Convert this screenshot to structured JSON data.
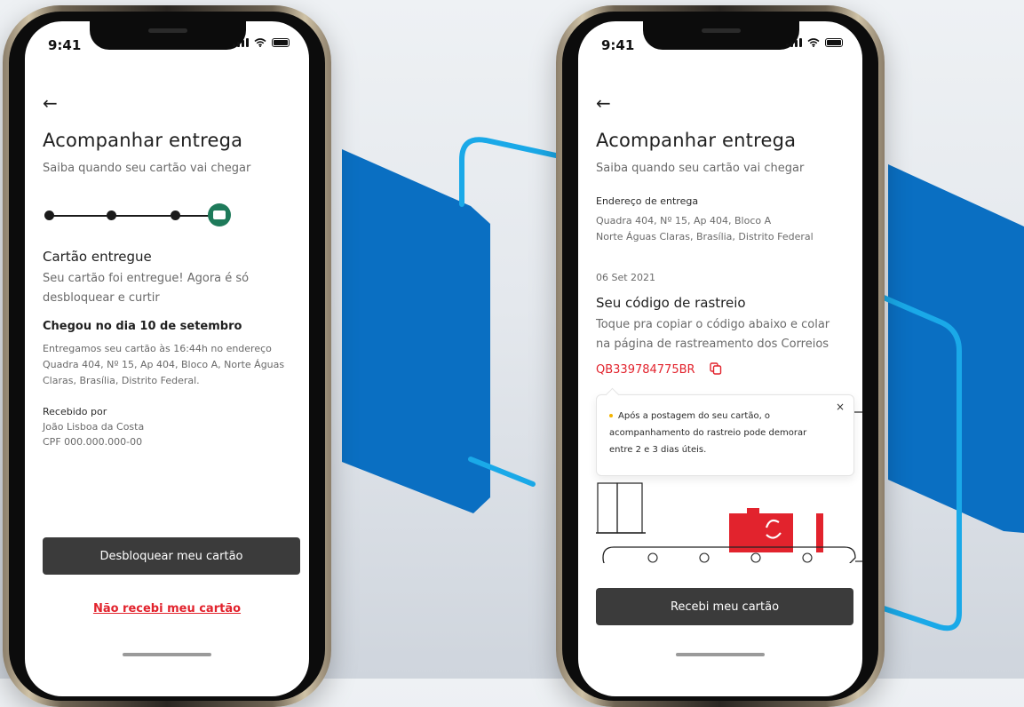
{
  "status": {
    "time": "9:41"
  },
  "left": {
    "title": "Acompanhar entrega",
    "subtitle": "Saiba quando seu cartão vai chegar",
    "status_heading": "Cartão entregue",
    "status_desc_line1": "Seu cartão foi entregue! Agora é só",
    "status_desc_line2": "desbloquear e curtir",
    "arrived_heading": "Chegou no dia 10 de setembro",
    "arrived_line1": "Entregamos seu cartão às 16:44h no endereço",
    "arrived_line2": "Quadra 404, Nº 15, Ap 404, Bloco A, Norte Águas",
    "arrived_line3": "Claras, Brasília, Distrito Federal.",
    "received_label": "Recebido por",
    "received_name": "João Lisboa da Costa",
    "received_cpf": "CPF 000.000.000-00",
    "primary_button": "Desbloquear meu cartão",
    "secondary_link": "Não recebi meu cartão",
    "steps_completed": 4,
    "steps_total": 4
  },
  "right": {
    "title": "Acompanhar entrega",
    "subtitle": "Saiba quando seu cartão vai chegar",
    "address_label": "Endereço de entrega",
    "address_line1": "Quadra 404, Nº 15, Ap 404, Bloco A",
    "address_line2": "Norte Águas Claras, Brasília, Distrito Federal",
    "date": "06 Set 2021",
    "tracking_heading": "Seu código de rastreio",
    "tracking_desc_line1": "Toque pra copiar o código abaixo e colar",
    "tracking_desc_line2": "na página de rastreamento dos Correios",
    "tracking_code": "QB339784775BR",
    "tooltip_line1": "Após a postagem do seu cartão, o",
    "tooltip_line2": "acompanhamento do rastreio pode demorar",
    "tooltip_line3": "entre 2 e 3 dias úteis.",
    "tooltip_close": "×",
    "primary_button": "Recebi meu cartão"
  },
  "colors": {
    "accent_blue": "#0a6fc2",
    "outline_cyan": "#1aa9e8",
    "button_dark": "#3b3b3b",
    "link_red": "#e2232d",
    "success_green": "#1e7a5a"
  },
  "icons": [
    "back-arrow-icon",
    "card-icon",
    "copy-icon",
    "close-icon",
    "signal-icon",
    "wifi-icon",
    "battery-icon"
  ]
}
